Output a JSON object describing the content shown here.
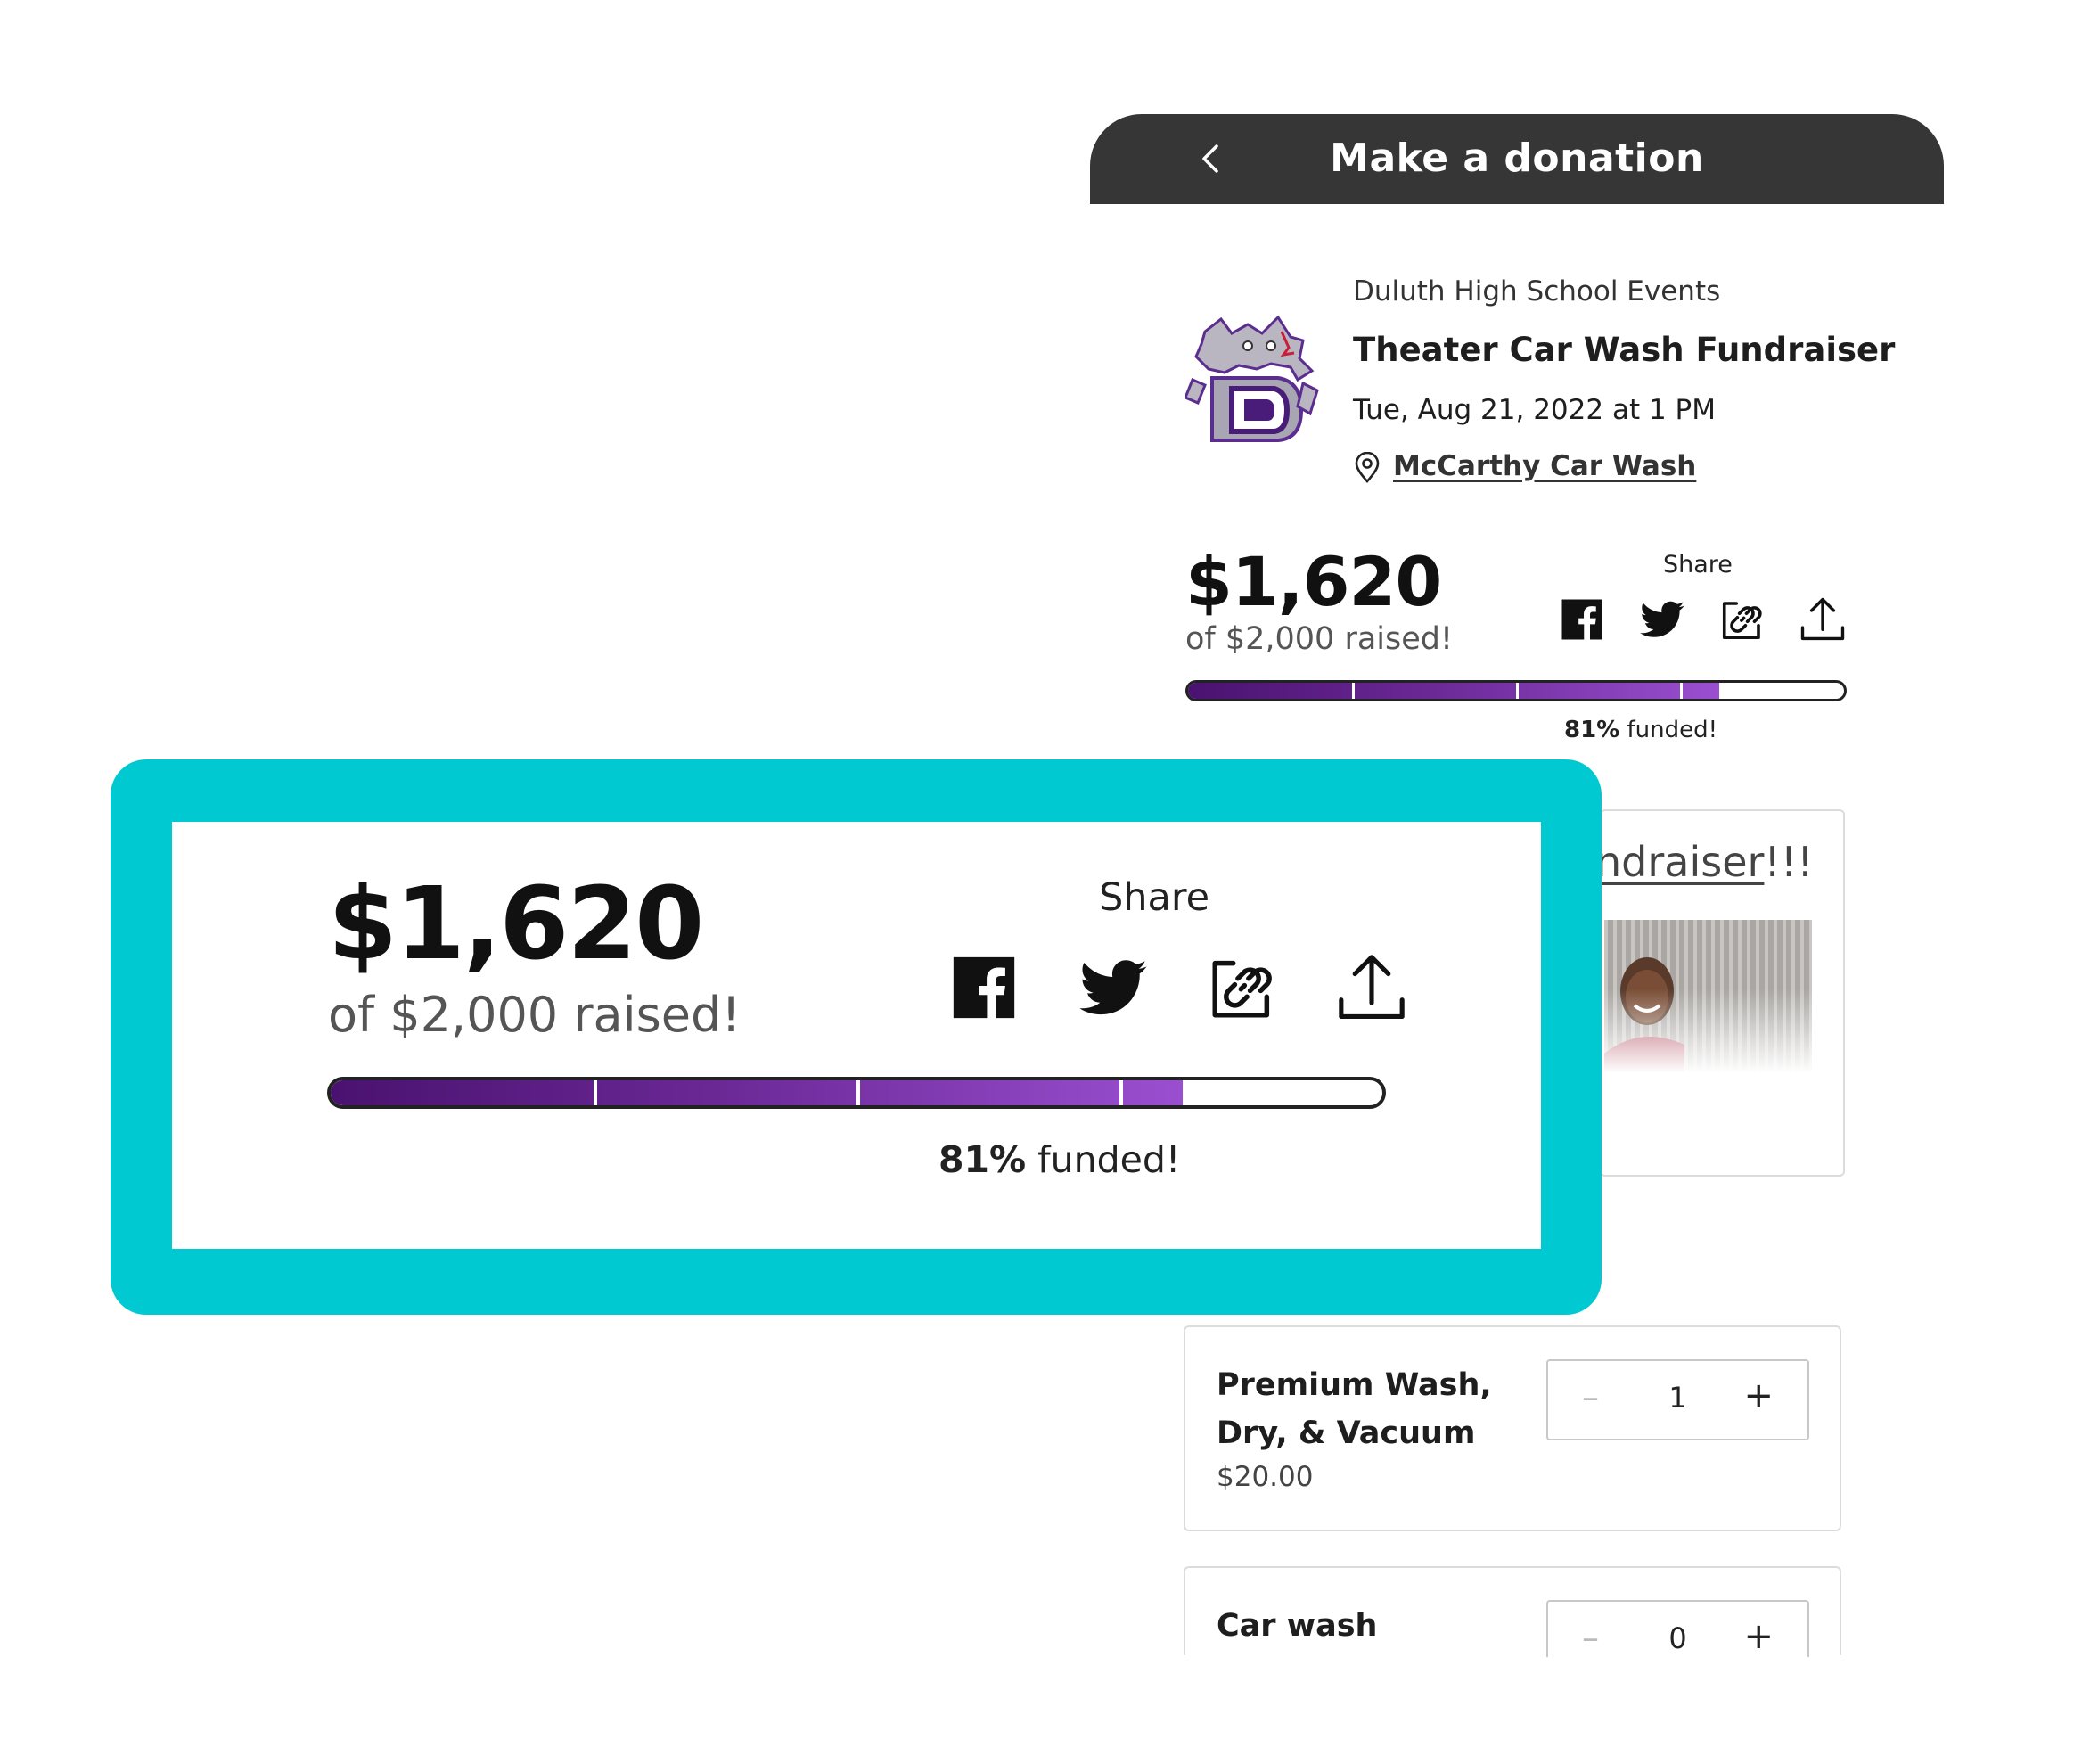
{
  "header": {
    "title": "Make a donation",
    "back_icon": "chevron-left-icon"
  },
  "event": {
    "organization": "Duluth High School Events",
    "title": "Theater Car Wash Fundraiser",
    "datetime": "Tue, Aug 21, 2022 at 1 PM",
    "location": "McCarthy Car Wash",
    "location_icon": "map-pin-icon",
    "logo": "duluth-wildcat-logo"
  },
  "fundraising": {
    "amount_raised": "$1,620",
    "goal_text": "of $2,000 raised!",
    "share_label": "Share",
    "percent_value": "81%",
    "percent_suffix": " funded!",
    "progress_fraction": 0.81,
    "share_icons": [
      "facebook-icon",
      "twitter-icon",
      "copy-link-icon",
      "share-upload-icon"
    ]
  },
  "announcement": {
    "link_fragment": "ndraiser",
    "trailing": "!!!"
  },
  "products": [
    {
      "name": "Premium Wash, Dry, & Vacuum",
      "price": "$20.00",
      "quantity": "1",
      "minus": "–",
      "plus": "+"
    },
    {
      "name": "Car wash",
      "quantity": "0",
      "minus": "–",
      "plus": "+"
    }
  ],
  "colors": {
    "header_bg": "#363636",
    "callout": "#00c9d2",
    "progress_start": "#4a1270",
    "progress_end": "#9a4fd0"
  }
}
